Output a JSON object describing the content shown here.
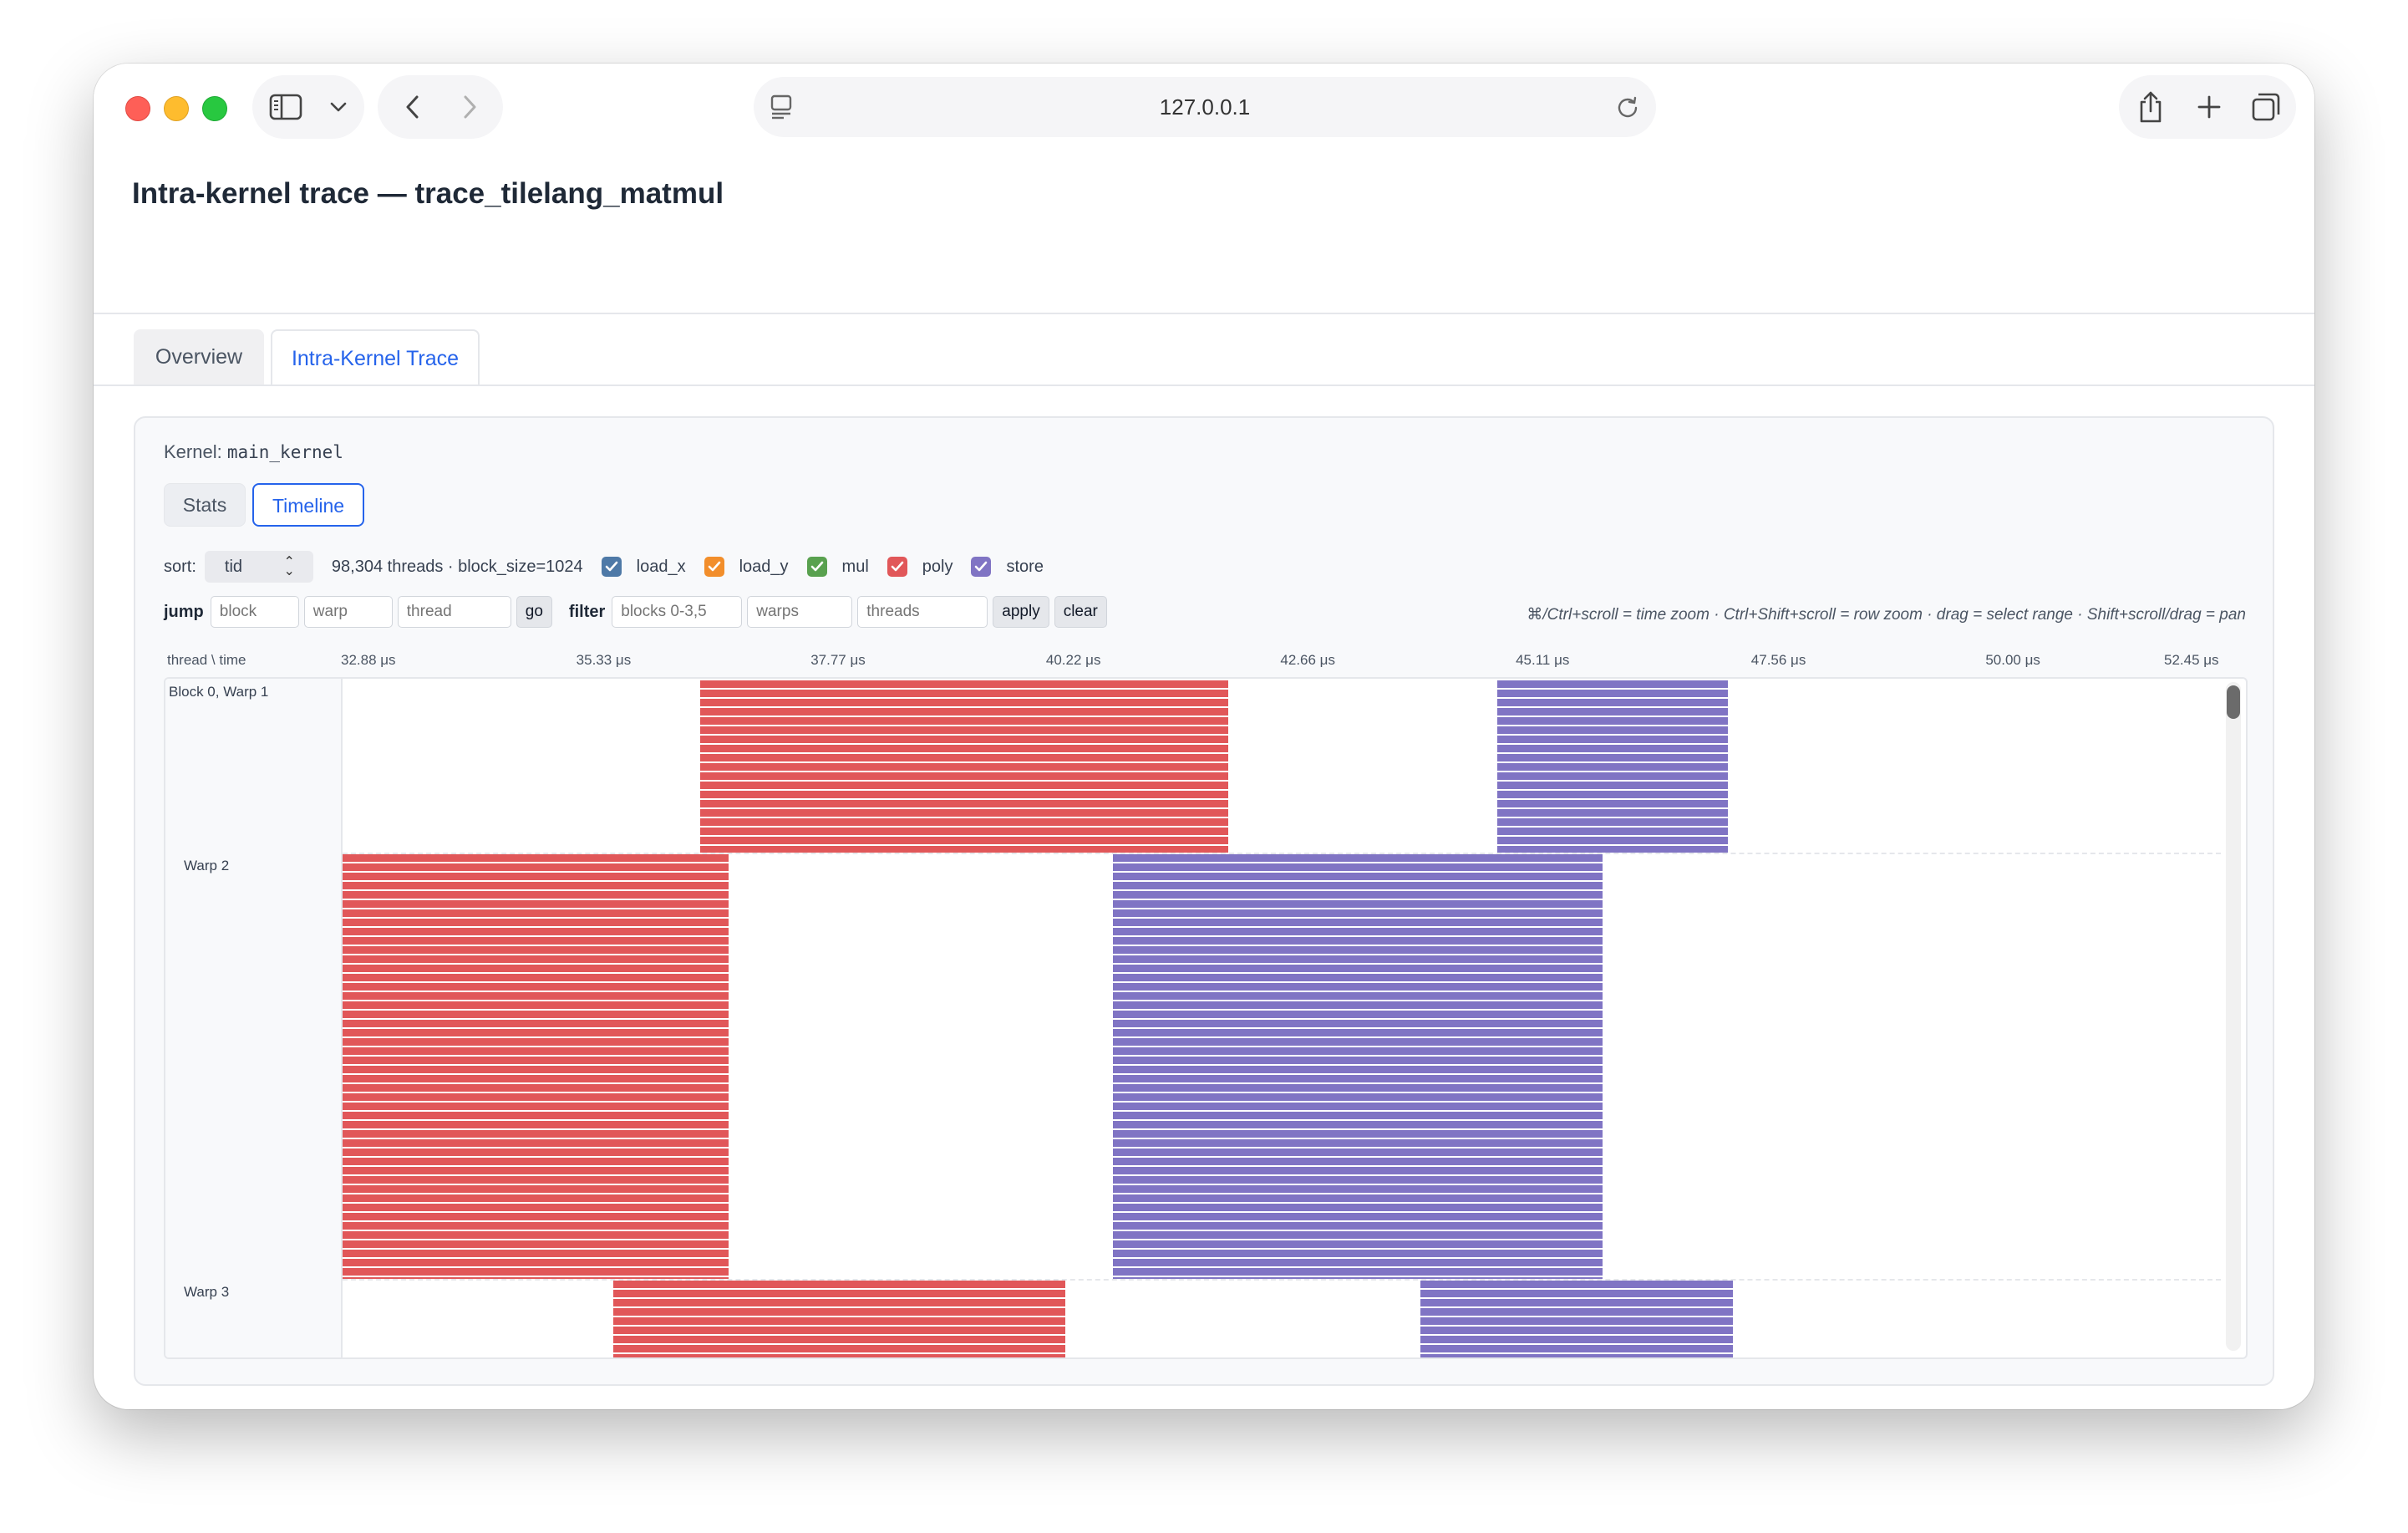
{
  "browser": {
    "url": "127.0.0.1",
    "icons": [
      "sidebar-icon",
      "chevron-down-icon",
      "back-icon",
      "forward-icon",
      "reader-icon",
      "reload-icon",
      "share-icon",
      "new-tab-icon",
      "tab-overview-icon"
    ]
  },
  "page": {
    "title": "Intra-kernel trace — trace_tilelang_matmul",
    "tabs": [
      {
        "label": "Overview",
        "active": false
      },
      {
        "label": "Intra-Kernel Trace",
        "active": true
      }
    ]
  },
  "panel": {
    "kernel_prefix": "Kernel:",
    "kernel_name": "main_kernel",
    "subtabs": [
      {
        "label": "Stats",
        "active": false
      },
      {
        "label": "Timeline",
        "active": true
      }
    ],
    "sort_label": "sort:",
    "sort_value": "tid",
    "info": "98,304 threads · block_size=1024",
    "legend": [
      {
        "label": "load_x",
        "color": "#4e79a7",
        "checked": true
      },
      {
        "label": "load_y",
        "color": "#f28e2b",
        "checked": true
      },
      {
        "label": "mul",
        "color": "#59a14f",
        "checked": true
      },
      {
        "label": "poly",
        "color": "#e15759",
        "checked": true
      },
      {
        "label": "store",
        "color": "#8074c4",
        "checked": true
      }
    ],
    "jump": {
      "label": "jump",
      "block_placeholder": "block",
      "warp_placeholder": "warp",
      "thread_placeholder": "thread",
      "go_label": "go"
    },
    "filter": {
      "label": "filter",
      "blocks_placeholder": "blocks 0-3,5",
      "warps_placeholder": "warps",
      "threads_placeholder": "threads",
      "apply_label": "apply",
      "clear_label": "clear"
    },
    "hint": "⌘/Ctrl+scroll = time zoom · Ctrl+Shift+scroll = row zoom · drag = select range · Shift+scroll/drag = pan"
  },
  "chart_data": {
    "type": "timeline",
    "axis_corner_label": "thread \\ time",
    "time_unit": "μs",
    "tick_labels": [
      "32.88 μs",
      "35.33 μs",
      "37.77 μs",
      "40.22 μs",
      "42.66 μs",
      "45.11 μs",
      "47.56 μs",
      "50.00 μs",
      "52.45 μs"
    ],
    "tick_values": [
      32.88,
      35.33,
      37.77,
      40.22,
      42.66,
      45.11,
      47.56,
      50.0,
      52.45
    ],
    "xlim": [
      32.88,
      52.45
    ],
    "rows": [
      {
        "label": "Block 0, Warp 1",
        "segments": [
          {
            "phase": "poly",
            "start": 36.6,
            "end": 42.1
          },
          {
            "phase": "store",
            "start": 44.9,
            "end": 47.3
          }
        ]
      },
      {
        "label": "Warp 2",
        "segments": [
          {
            "phase": "poly",
            "start": 32.88,
            "end": 36.9
          },
          {
            "phase": "store",
            "start": 40.9,
            "end": 46.0
          }
        ]
      },
      {
        "label": "Warp 3",
        "segments": [
          {
            "phase": "poly",
            "start": 35.7,
            "end": 40.4
          },
          {
            "phase": "store",
            "start": 44.1,
            "end": 47.35
          }
        ]
      }
    ]
  }
}
